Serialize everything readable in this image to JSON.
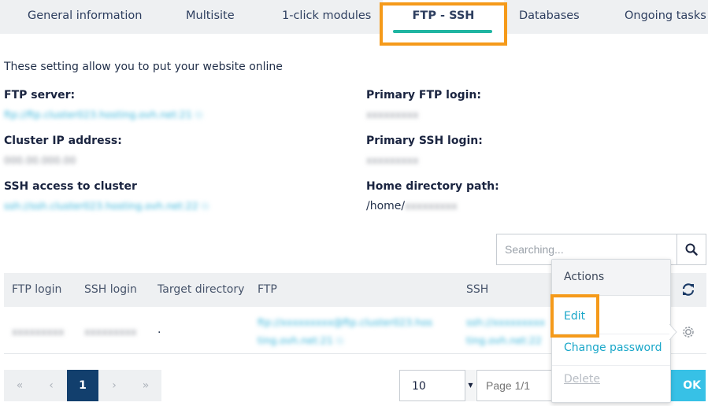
{
  "tabs": [
    {
      "label": "General information"
    },
    {
      "label": "Multisite"
    },
    {
      "label": "1-click modules"
    },
    {
      "label": "FTP - SSH",
      "active": true
    },
    {
      "label": "Databases"
    },
    {
      "label": "Ongoing tasks"
    }
  ],
  "colors": {
    "accent": "#1fb5a2",
    "highlight": "#f59a1a",
    "link": "#1aa7c9",
    "primary": "#123f6d"
  },
  "intro": "These setting allow you to put your website online",
  "info": {
    "ftp_server_label": "FTP server:",
    "ftp_server_value": "ftp://ftp.cluster023.hosting.ovh.net:21",
    "cluster_ip_label": "Cluster IP address:",
    "cluster_ip_value": "000.00.000.00",
    "ssh_access_label": "SSH access to cluster",
    "ssh_access_value": "ssh://ssh.cluster023.hosting.ovh.net:22",
    "primary_ftp_label": "Primary FTP login:",
    "primary_ftp_value": "xxxxxxxxx",
    "primary_ssh_label": "Primary SSH login:",
    "primary_ssh_value": "xxxxxxxxx",
    "home_dir_label": "Home directory path:",
    "home_dir_prefix": "/home/",
    "home_dir_user": "xxxxxxxxx"
  },
  "search": {
    "placeholder": "Searching...",
    "icon": "search-icon"
  },
  "table": {
    "columns": [
      "FTP login",
      "SSH login",
      "Target directory",
      "FTP",
      "SSH"
    ],
    "row": {
      "ftp_login": "xxxxxxxxx",
      "ssh_login": "xxxxxxxxx",
      "target_dir": ".",
      "ftp_line1": "ftp://xxxxxxxxx@ftp.cluster023.hos",
      "ftp_line2": "ting.ovh.net:21",
      "ssh_line1": "ssh://xxxxxxxxx",
      "ssh_line2": "ting.ovh.net:22"
    }
  },
  "menu": {
    "header": "Actions",
    "items": [
      "Edit",
      "Change password",
      "Delete"
    ]
  },
  "pagination": {
    "first": "«",
    "prev": "‹",
    "current": "1",
    "next": "›",
    "last": "»",
    "page_size": "10",
    "page_placeholder": "Page 1/1",
    "ok_label": "OK"
  }
}
